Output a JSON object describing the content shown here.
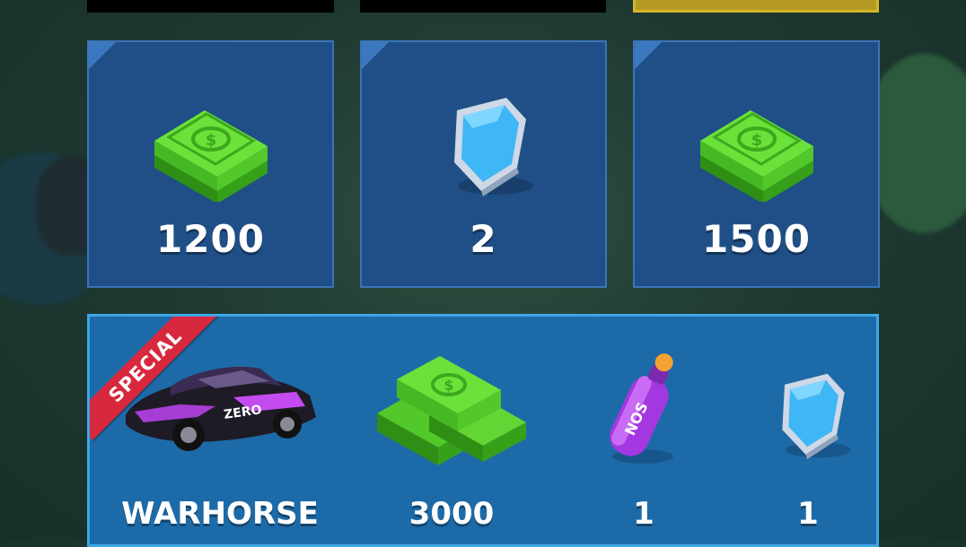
{
  "top_row": [
    {
      "style": "dark"
    },
    {
      "style": "dark"
    },
    {
      "style": "gold"
    }
  ],
  "reward_cards": [
    {
      "icon": "cash-stack-icon",
      "value": "1200"
    },
    {
      "icon": "shield-gem-icon",
      "value": "2"
    },
    {
      "icon": "cash-stack-icon",
      "value": "1500"
    }
  ],
  "special_offer": {
    "badge": "SPECIAL",
    "items": [
      {
        "icon": "sports-car-icon",
        "label": "WARHORSE"
      },
      {
        "icon": "cash-pile-icon",
        "label": "3000"
      },
      {
        "icon": "nos-bottle-icon",
        "label": "1"
      },
      {
        "icon": "shield-gem-icon",
        "label": "1"
      }
    ]
  },
  "colors": {
    "card_bg": "#1f4f86",
    "panel_bg": "#1d6aa8",
    "ribbon": "#d8283d",
    "cash_green": "#5ed62f",
    "shield_blue": "#3fb6f5"
  }
}
